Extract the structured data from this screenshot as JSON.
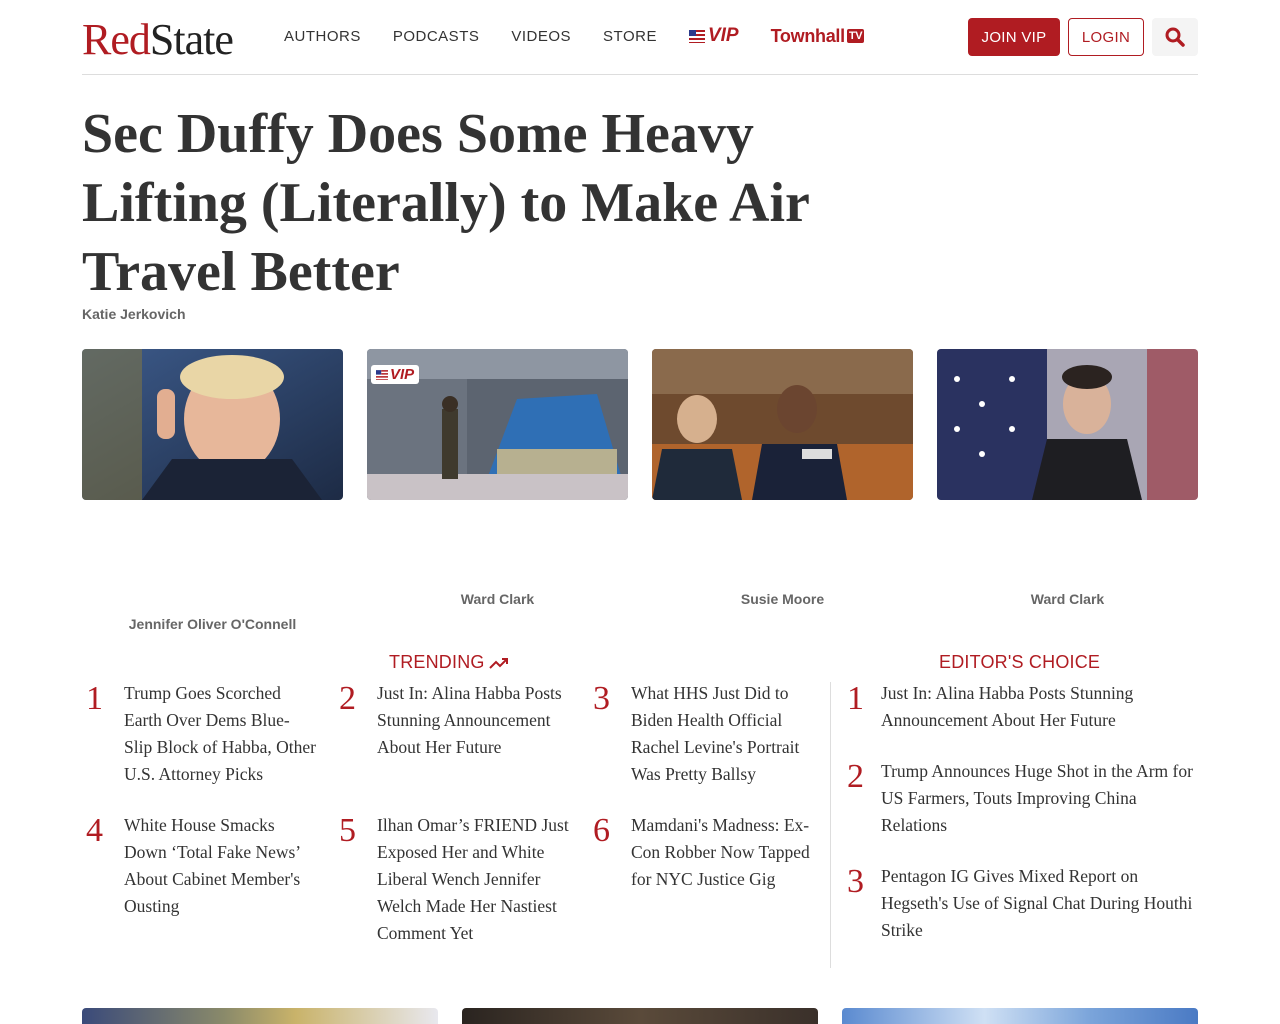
{
  "header": {
    "logo_part1": "Red",
    "logo_part2": "State",
    "nav": [
      "AUTHORS",
      "PODCASTS",
      "VIDEOS",
      "STORE"
    ],
    "vip_label": "VIP",
    "townhall_label": "Townhall",
    "townhall_tv": "TV",
    "join_label": "JOIN VIP",
    "login_label": "LOGIN"
  },
  "article": {
    "headline": "Sec Duffy Does Some Heavy Lifting (Literally) to Make Air Travel Better",
    "author": "Katie Jerkovich"
  },
  "cards": [
    {
      "author": "Jennifer Oliver O'Connell",
      "vip": false
    },
    {
      "author": "Ward Clark",
      "vip": true,
      "vip_label": "VIP"
    },
    {
      "author": "Susie Moore",
      "vip": false
    },
    {
      "author": "Ward Clark",
      "vip": false
    }
  ],
  "trending": {
    "title": "TRENDING",
    "items": [
      {
        "num": "1",
        "text": "Trump Goes Scorched Earth Over Dems Blue-Slip Block of Habba, Other U.S. Attorney Picks"
      },
      {
        "num": "2",
        "text": "Just In: Alina Habba Posts Stunning Announcement About Her Future"
      },
      {
        "num": "3",
        "text": "What HHS Just Did to Biden Health Official Rachel Levine's Portrait Was Pretty Ballsy"
      },
      {
        "num": "4",
        "text": "White House Smacks Down ‘Total Fake News’ About Cabinet Member's Ousting"
      },
      {
        "num": "5",
        "text": "Ilhan Omar’s FRIEND Just Exposed Her and White Liberal Wench Jennifer Welch Made Her Nastiest Comment Yet"
      },
      {
        "num": "6",
        "text": "Mamdani's Madness: Ex-Con Robber Now Tapped for NYC Justice Gig"
      }
    ]
  },
  "editors_choice": {
    "title": "EDITOR'S CHOICE",
    "items": [
      {
        "num": "1",
        "text": "Just In: Alina Habba Posts Stunning Announcement About Her Future"
      },
      {
        "num": "2",
        "text": "Trump Announces Huge Shot in the Arm for US Farmers, Touts Improving China Relations"
      },
      {
        "num": "3",
        "text": "Pentagon IG Gives Mixed Report on Hegseth's Use of Signal Chat During Houthi Strike"
      }
    ]
  },
  "colors": {
    "brand_red": "#b01c22",
    "text": "#333333",
    "muted": "#666666"
  }
}
